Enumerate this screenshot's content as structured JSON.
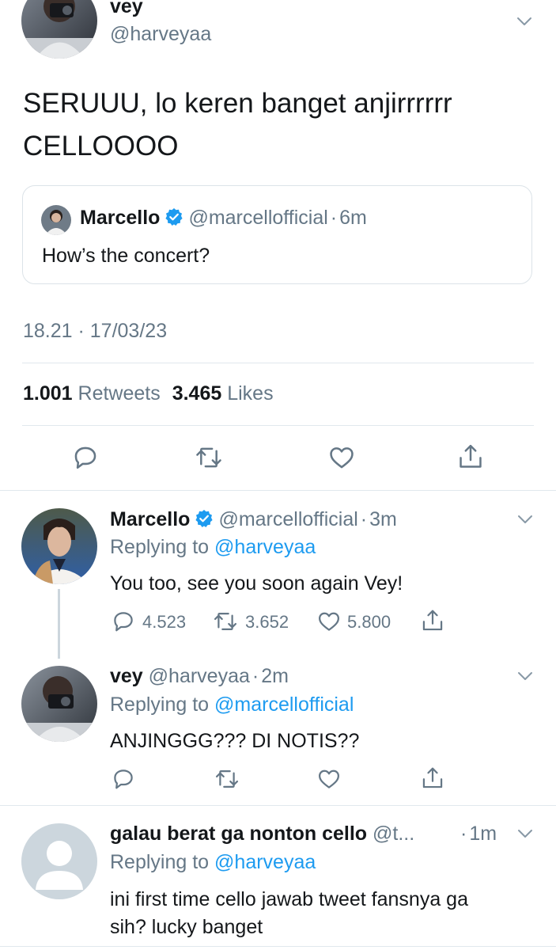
{
  "main_tweet": {
    "name": "vey",
    "handle": "@harveyaa",
    "text_line1": "SERUUU, lo keren banget anjirrrrrr",
    "text_line2": "CELLOOOO",
    "quote": {
      "name": "Marcello",
      "handle": "@marcellofficial",
      "sep": "·",
      "time": "6m",
      "text": "How’s the concert?"
    },
    "timestamp": "18.21 · 17/03/23",
    "retweets_count": "1.001",
    "retweets_label": "Retweets",
    "likes_count": "3.465",
    "likes_label": "Likes"
  },
  "replies": [
    {
      "name": "Marcello",
      "handle": "@marcellofficial",
      "sep": "·",
      "time": "3m",
      "replying_prefix": "Replying to",
      "replying_to": "@harveyaa",
      "text": "You too, see you soon again Vey!",
      "reply_count": "4.523",
      "retweet_count": "3.652",
      "like_count": "5.800"
    },
    {
      "name": "vey",
      "handle": "@harveyaa",
      "sep": "·",
      "time": "2m",
      "replying_prefix": "Replying to",
      "replying_to": "@marcellofficial",
      "text": "ANJINGGG??? DI NOTIS??"
    },
    {
      "name": "galau berat ga nonton cello",
      "handle": "@t...",
      "sep": "·",
      "time": "1m",
      "replying_prefix": "Replying to",
      "replying_to": "@harveyaa",
      "text_line1": "ini first time cello jawab tweet fansnya ga",
      "text_line2": "sih? lucky banget"
    }
  ],
  "colors": {
    "accent": "#1d9bf0",
    "secondary_text": "#657786",
    "divider": "#e1e8ed"
  },
  "icons": [
    "reply-icon",
    "retweet-icon",
    "like-icon",
    "share-icon",
    "chevron-down-icon",
    "verified-badge-icon"
  ]
}
